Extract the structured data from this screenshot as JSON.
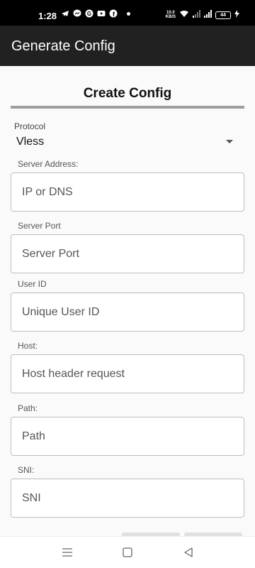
{
  "status_bar": {
    "time": "1:28",
    "net_speed_value": "10.0",
    "net_speed_unit": "KB/S",
    "battery": "44"
  },
  "app_bar": {
    "title": "Generate Config"
  },
  "form": {
    "heading": "Create Config",
    "protocol": {
      "label": "Protocol",
      "value": "Vless"
    },
    "fields": [
      {
        "label": "Server Address:",
        "placeholder": "IP or DNS"
      },
      {
        "label": "Server Port",
        "placeholder": "Server Port"
      },
      {
        "label": "User ID",
        "placeholder": "Unique User ID"
      },
      {
        "label": "Host:",
        "placeholder": "Host header request"
      },
      {
        "label": "Path:",
        "placeholder": "Path"
      },
      {
        "label": "SNI:",
        "placeholder": "SNI"
      }
    ]
  },
  "icons": {
    "status_apps": [
      "telegram-icon",
      "messenger-icon",
      "google-icon",
      "youtube-icon",
      "facebook-icon"
    ],
    "nav": [
      "menu-icon",
      "home-icon",
      "back-icon"
    ]
  },
  "colors": {
    "app_bar": "#212121",
    "status_bar": "#000000",
    "heading_rule": "#9e9e9e",
    "field_border": "#bdbdbd"
  }
}
